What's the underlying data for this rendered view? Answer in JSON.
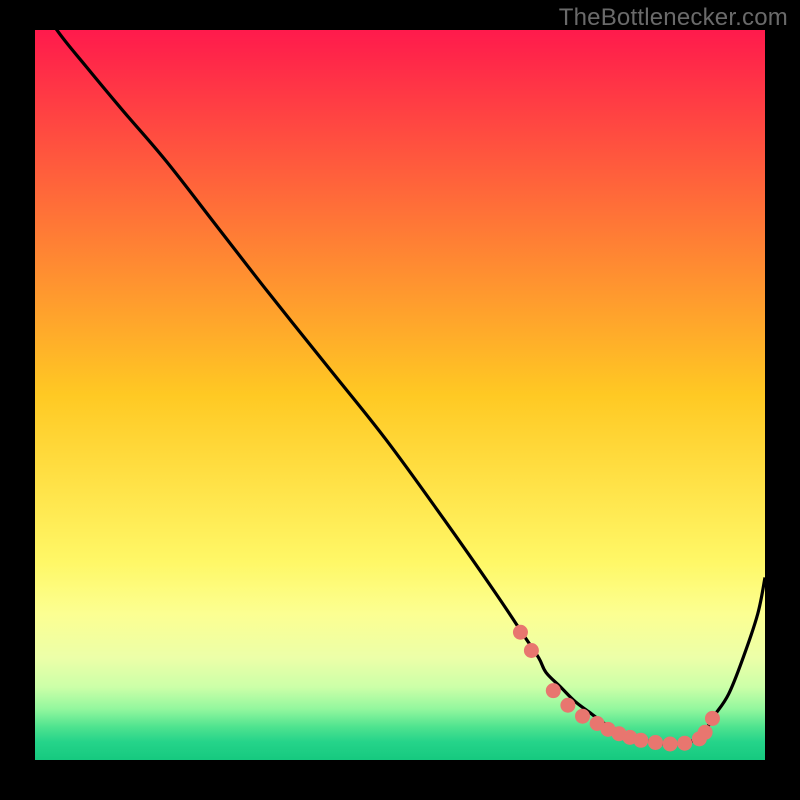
{
  "watermark": "TheBottlenecker.com",
  "colors": {
    "page_bg": "#000000",
    "line": "#000000",
    "marker_fill": "#e8766f",
    "marker_stroke": "#e8766f",
    "gradient_stops": [
      {
        "offset": 0.0,
        "color": "#ff1a4c"
      },
      {
        "offset": 0.5,
        "color": "#ffc923"
      },
      {
        "offset": 0.73,
        "color": "#fff867"
      },
      {
        "offset": 0.8,
        "color": "#fcff92"
      },
      {
        "offset": 0.86,
        "color": "#ecffa8"
      },
      {
        "offset": 0.9,
        "color": "#ccffa8"
      },
      {
        "offset": 0.93,
        "color": "#93f79e"
      },
      {
        "offset": 0.955,
        "color": "#4ee38f"
      },
      {
        "offset": 0.975,
        "color": "#25d48a"
      },
      {
        "offset": 1.0,
        "color": "#16c97f"
      }
    ]
  },
  "chart_data": {
    "type": "line",
    "title": "",
    "xlabel": "",
    "ylabel": "",
    "xlim": [
      0,
      100
    ],
    "ylim": [
      0,
      100
    ],
    "series": [
      {
        "name": "curve",
        "x": [
          0,
          3,
          7,
          12,
          18,
          25,
          32,
          40,
          48,
          56,
          63,
          67,
          69,
          70,
          72,
          74,
          76,
          78,
          80,
          82,
          84,
          86,
          88,
          90,
          91,
          92,
          93,
          95,
          97,
          99,
          100
        ],
        "values": [
          105,
          100,
          95,
          89,
          82,
          73,
          64,
          54,
          44,
          33,
          23,
          17,
          14,
          12,
          10,
          8,
          6.5,
          5.0,
          4.0,
          3.2,
          2.6,
          2.2,
          2.2,
          2.6,
          3.2,
          4.3,
          6.0,
          9.0,
          14,
          20,
          25
        ]
      }
    ],
    "markers": {
      "x": [
        66.5,
        68.0,
        71.0,
        73.0,
        75.0,
        77.0,
        78.5,
        80.0,
        81.5,
        83.0,
        85.0,
        87.0,
        89.0,
        91.0,
        91.8,
        92.8
      ],
      "values": [
        17.5,
        15.0,
        9.5,
        7.5,
        6.0,
        5.0,
        4.2,
        3.6,
        3.1,
        2.7,
        2.4,
        2.2,
        2.3,
        2.9,
        3.8,
        5.7
      ]
    }
  }
}
